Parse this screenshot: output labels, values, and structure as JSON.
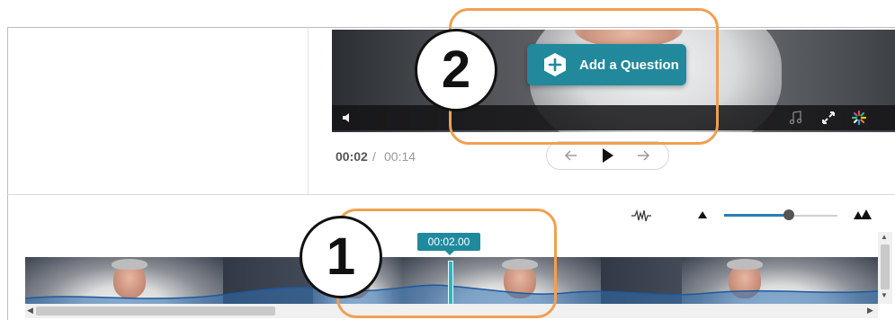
{
  "video": {
    "add_question_label": "Add a Question",
    "current_time": "00:02",
    "time_separator": "/",
    "duration": "00:14"
  },
  "timeline": {
    "playhead_time": "00:02.00"
  },
  "callouts": {
    "step_1": "1",
    "step_2": "2"
  },
  "icons": {
    "volume": "volume-icon",
    "music": "music-note-icon",
    "fullscreen": "fullscreen-icon",
    "captions": "color-wheel-icon",
    "prev": "arrow-left-icon",
    "play": "play-icon",
    "next": "arrow-right-icon",
    "waveform": "waveform-icon",
    "zoom_out": "triangle-small-icon",
    "zoom_in": "triangle-large-icon",
    "add": "plus-hexagon-icon"
  },
  "colors": {
    "accent_teal": "#21899b",
    "callout_orange": "#f0a050",
    "playhead": "#2bb6c4",
    "zoom_fill": "#2a7eb0"
  },
  "zoom_level": 0.53
}
